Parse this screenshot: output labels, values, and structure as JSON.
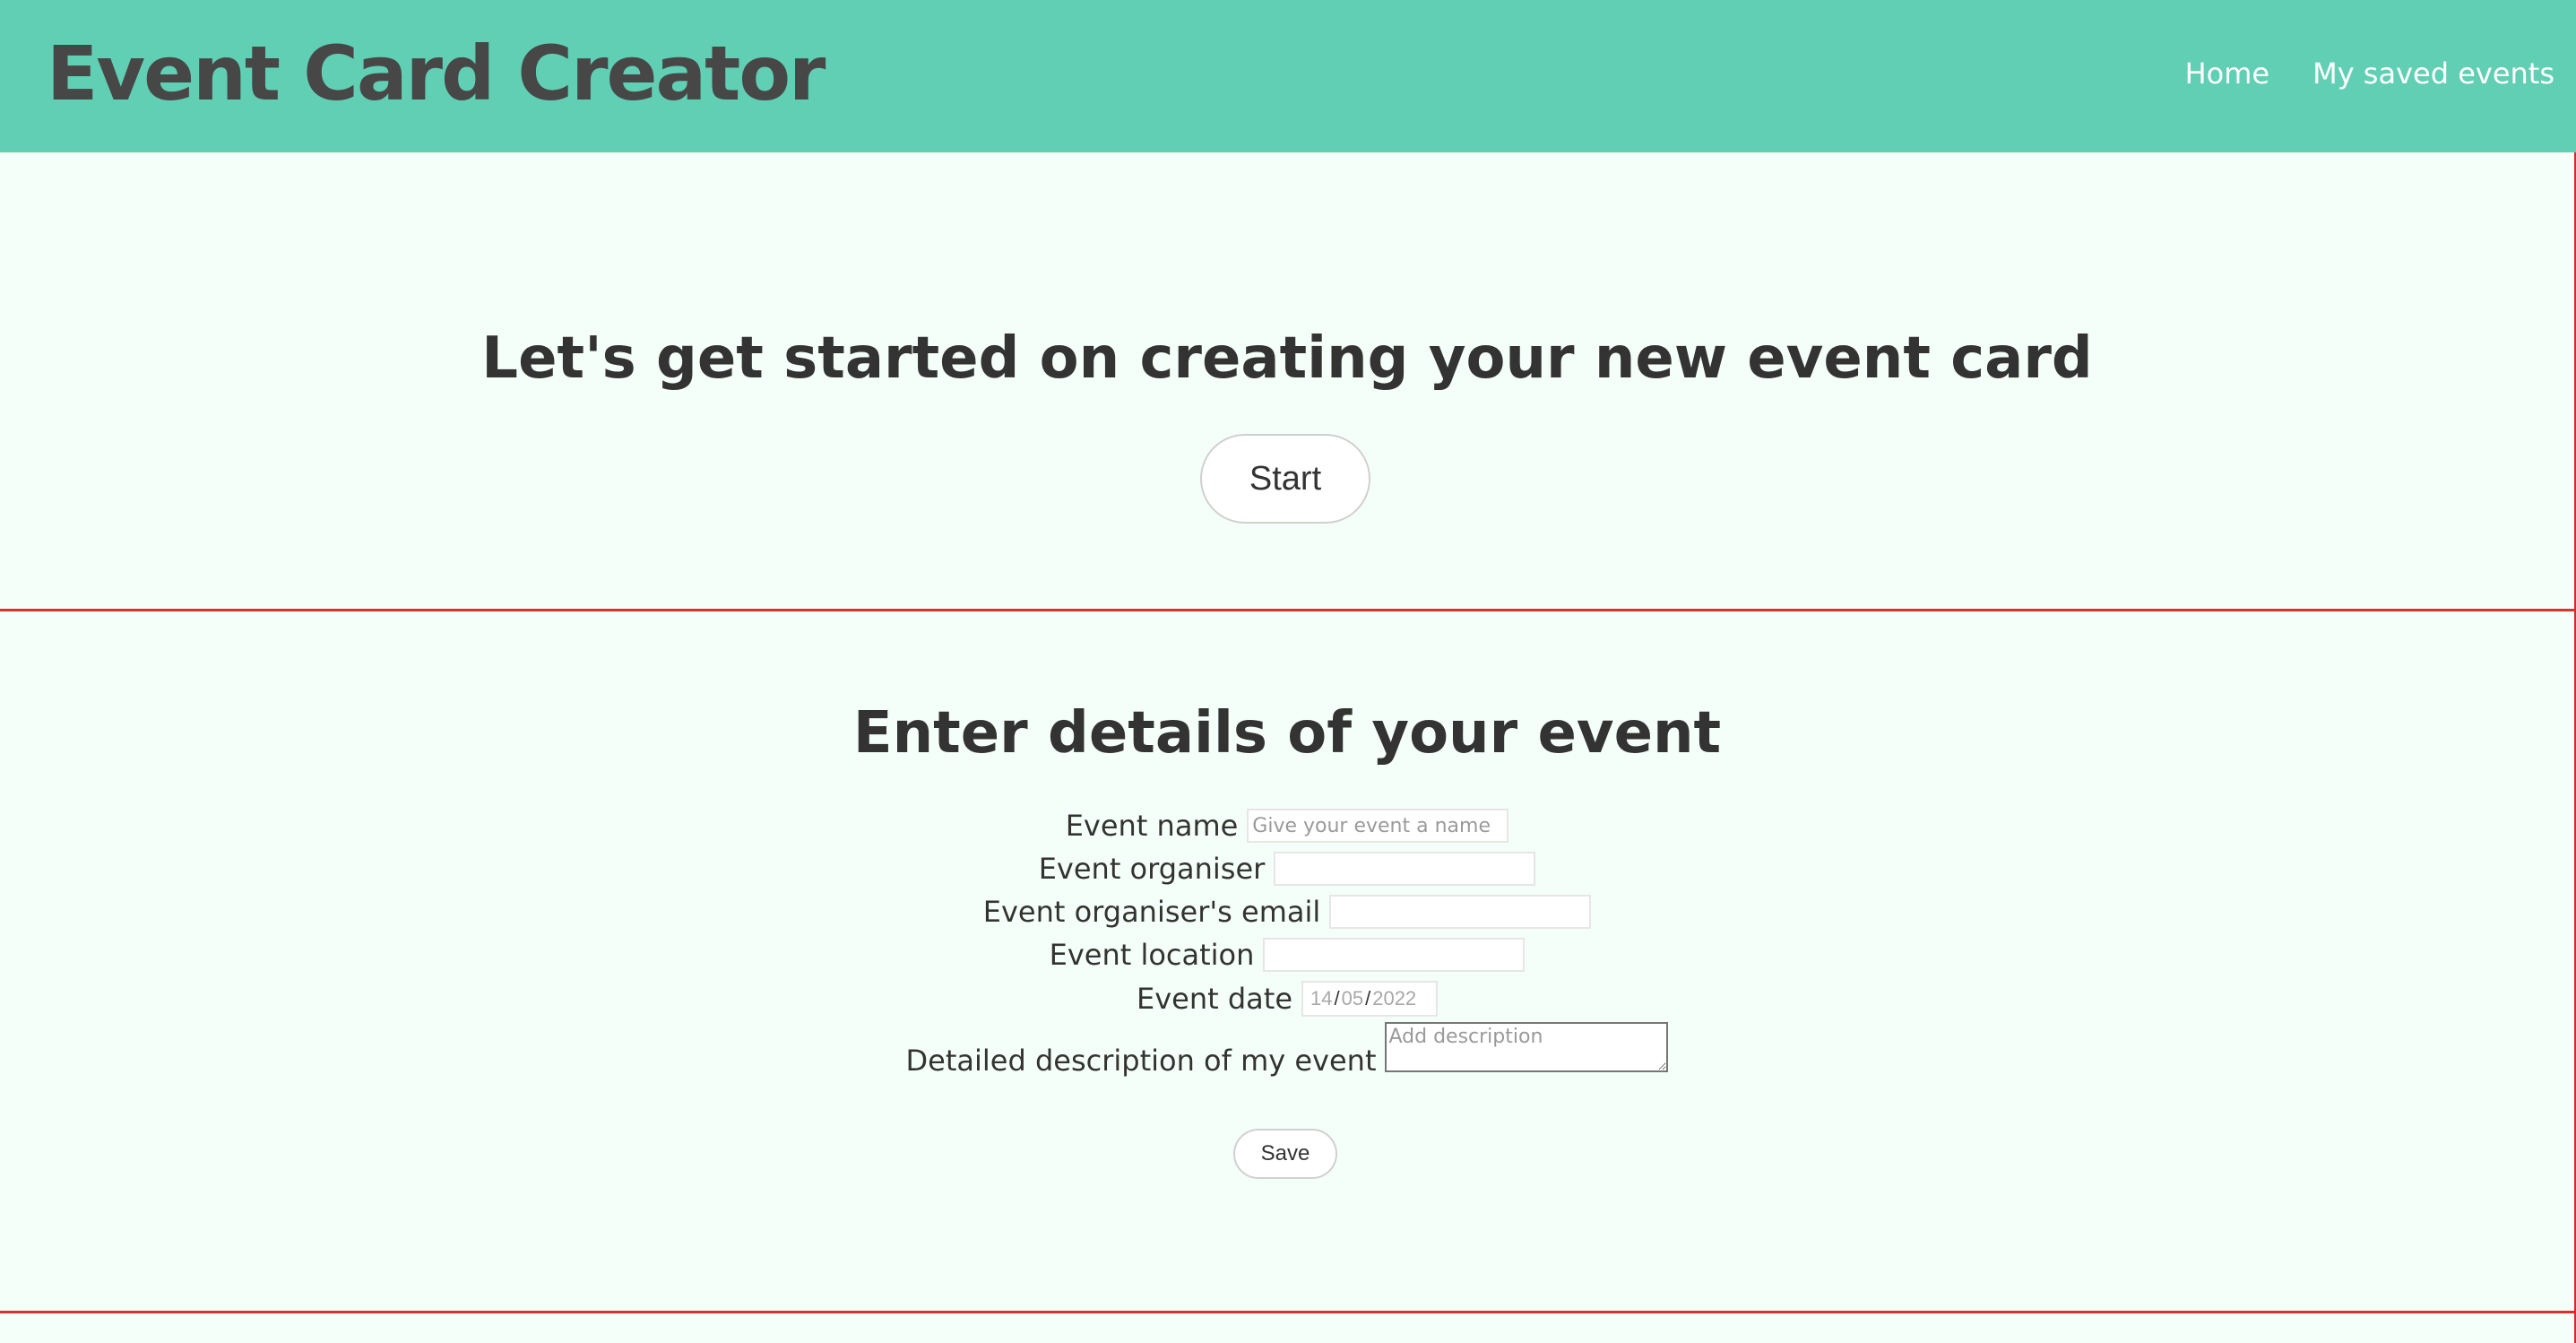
{
  "header": {
    "app_title": "Event Card Creator",
    "nav": {
      "home": "Home",
      "saved": "My saved events"
    }
  },
  "hero": {
    "heading": "Let's get started on creating your new event card",
    "start_label": "Start"
  },
  "form": {
    "heading": "Enter details of your event",
    "event_name": {
      "label": "Event name",
      "placeholder": "Give your event a name",
      "value": ""
    },
    "organiser": {
      "label": "Event organiser",
      "value": ""
    },
    "organiser_email": {
      "label": "Event organiser's email",
      "value": ""
    },
    "location": {
      "label": "Event location",
      "value": ""
    },
    "date": {
      "label": "Event date",
      "day": "14",
      "month": "05",
      "year": "2022",
      "separator": "/"
    },
    "description": {
      "label": "Detailed description of my event",
      "placeholder": "Add description",
      "value": ""
    },
    "save_label": "Save"
  },
  "colors": {
    "header_bg": "#61cfb3",
    "page_bg": "#f5fff9",
    "divider": "#d9302a",
    "title_text": "#474747",
    "nav_text": "#ffffff"
  }
}
